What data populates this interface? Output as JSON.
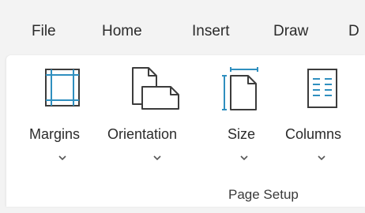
{
  "menu": {
    "tabs": [
      {
        "label": "File"
      },
      {
        "label": "Home"
      },
      {
        "label": "Insert"
      },
      {
        "label": "Draw"
      },
      {
        "label": "D"
      }
    ]
  },
  "page_setup": {
    "group_label": "Page Setup",
    "commands": [
      {
        "label": "Margins",
        "icon": "margins-icon"
      },
      {
        "label": "Orientation",
        "icon": "orientation-icon"
      },
      {
        "label": "Size",
        "icon": "size-icon"
      },
      {
        "label": "Columns",
        "icon": "columns-icon"
      }
    ]
  },
  "colors": {
    "accent": "#2f8fbf",
    "icon_stroke": "#3c3c3c",
    "ribbon_bg": "#ffffff",
    "menubar_bg": "#f3f3f3"
  }
}
